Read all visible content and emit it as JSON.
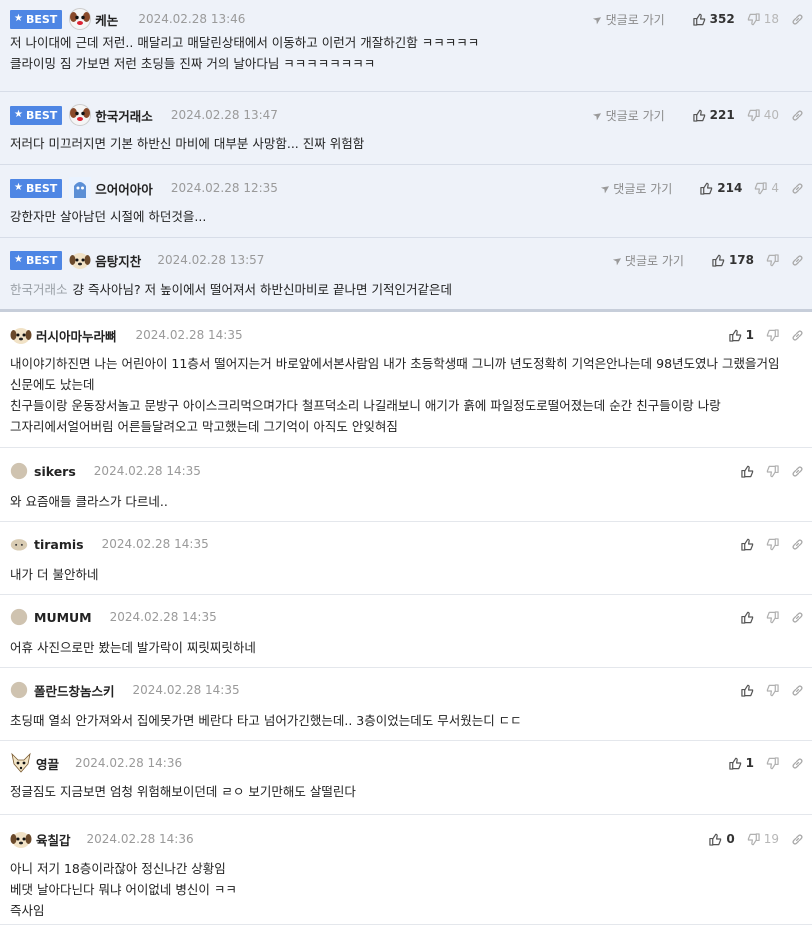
{
  "labels": {
    "best": "BEST",
    "reply": "댓글로 가기"
  },
  "colors": {
    "best_badge": "#4e86e4",
    "best_bg": "#eef2f9"
  },
  "comments": [
    {
      "best": true,
      "nick": "케논",
      "date": "2024.02.28 13:46",
      "show_reply": true,
      "up": "352",
      "down": "18",
      "lines": [
        "저 나이대에 근데 저런.. 매달리고 매달린상태에서 이동하고 이런거 개잘하긴함 ㅋㅋㅋㅋㅋ",
        "클라이밍 짐 가보면 저런 초딩들 진짜 거의 날아다님 ㅋㅋㅋㅋㅋㅋㅋㅋ"
      ]
    },
    {
      "best": true,
      "nick": "한국거래소",
      "date": "2024.02.28 13:47",
      "show_reply": true,
      "up": "221",
      "down": "40",
      "lines": [
        "저러다 미끄러지면 기본 하반신 마비에 대부분 사망함... 진짜 위험함"
      ]
    },
    {
      "best": true,
      "nick": "으어어아아",
      "date": "2024.02.28 12:35",
      "show_reply": true,
      "up": "214",
      "down": "4",
      "lines": [
        "강한자만 살아남던 시절에 하던것을..."
      ]
    },
    {
      "best": true,
      "nick": "음탕지찬",
      "date": "2024.02.28 13:57",
      "show_reply": true,
      "up": "178",
      "down": "",
      "mention": "한국거래소",
      "lines": [
        "걍 즉사아님? 저 높이에서 떨어져서 하반신마비로 끝나면 기적인거같은데"
      ]
    },
    {
      "best": false,
      "nick": "러시아마누라뼈",
      "date": "2024.02.28 14:35",
      "show_reply": false,
      "up": "1",
      "down": "",
      "lines": [
        "내이야기하진면 나는 어린아이 11층서 떨어지는거 바로앞에서본사람임 내가 초등학생때 그니까 년도정확히 기억은안나는데 98년도였나 그랬을거임 신문에도 났는데",
        "친구들이랑 운동장서놀고 문방구 아이스크리먹으며가다 철프덕소리 나길래보니 애기가 흙에 파일정도로떨어졌는데 순간 친구들이랑 나랑 그자리에서얼어버림 어른들달려오고 막고했는데 그기억이 아직도 안잊혀짐"
      ]
    },
    {
      "best": false,
      "nick": "sikers",
      "date": "2024.02.28 14:35",
      "show_reply": false,
      "up": "",
      "down": "",
      "lines": [
        "와 요즘애들 클라스가 다르네.."
      ]
    },
    {
      "best": false,
      "nick": "tiramis",
      "date": "2024.02.28 14:35",
      "show_reply": false,
      "up": "",
      "down": "",
      "lines": [
        "내가 더 불안하네"
      ]
    },
    {
      "best": false,
      "nick": "MUMUM",
      "date": "2024.02.28 14:35",
      "show_reply": false,
      "up": "",
      "down": "",
      "lines": [
        "어휴 사진으로만 봤는데 발가락이 찌릿찌릿하네"
      ]
    },
    {
      "best": false,
      "nick": "폴란드창놈스키",
      "date": "2024.02.28 14:35",
      "show_reply": false,
      "up": "",
      "down": "",
      "lines": [
        "초딩때 열쇠 안가져와서 집에못가면 베란다 타고 넘어가긴했는데.. 3층이었는데도 무서웠는디 ㄷㄷ"
      ]
    },
    {
      "best": false,
      "nick": "영끌",
      "date": "2024.02.28 14:36",
      "show_reply": false,
      "up": "1",
      "down": "",
      "lines": [
        "정글짐도 지금보면 엄청 위험해보이던데 ㄹㅇ 보기만해도 살떨린다"
      ]
    },
    {
      "best": false,
      "nick": "육칠갑",
      "date": "2024.02.28 14:36",
      "show_reply": false,
      "up": "0",
      "down": "19",
      "lines": [
        "아니 저기 18층이라잖아 정신나간 상황임",
        "베댓 날아다닌다 뭐냐 어이없네 병신이 ㅋㅋ",
        "즉사임"
      ]
    }
  ]
}
